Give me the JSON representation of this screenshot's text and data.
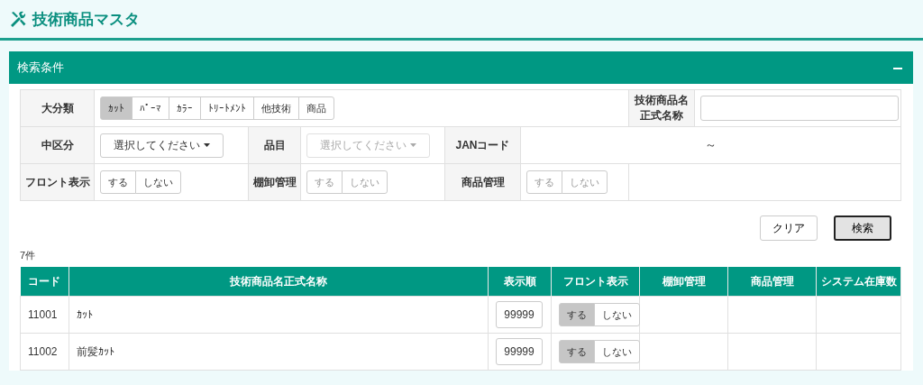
{
  "page": {
    "title": "技術商品マスタ"
  },
  "search_panel": {
    "title": "検索条件",
    "category": {
      "label": "大分類",
      "options": [
        {
          "label": "ｶｯﾄ",
          "selected": true
        },
        {
          "label": "ﾊﾟｰﾏ",
          "selected": false
        },
        {
          "label": "ｶﾗｰ",
          "selected": false
        },
        {
          "label": "ﾄﾘｰﾄﾒﾝﾄ",
          "selected": false
        },
        {
          "label": "他技術",
          "selected": false
        },
        {
          "label": "商品",
          "selected": false
        }
      ]
    },
    "name_field": {
      "label": "技術商品名正式名称"
    },
    "middle_class": {
      "label": "中区分",
      "placeholder": "選択してください",
      "disabled": false
    },
    "item": {
      "label": "品目",
      "placeholder": "選択してください",
      "disabled": true
    },
    "jan_code": {
      "label": "JANコード",
      "separator": "～"
    },
    "front_display": {
      "label": "フロント表示",
      "disabled": false,
      "options": [
        {
          "label": "する",
          "selected": false
        },
        {
          "label": "しない",
          "selected": false
        }
      ]
    },
    "inventory": {
      "label": "棚卸管理",
      "disabled": true,
      "options": [
        {
          "label": "する",
          "selected": false
        },
        {
          "label": "しない",
          "selected": false
        }
      ]
    },
    "product_mgmt": {
      "label": "商品管理",
      "disabled": true,
      "options": [
        {
          "label": "する",
          "selected": false
        },
        {
          "label": "しない",
          "selected": false
        }
      ]
    },
    "buttons": [
      {
        "label": "クリア",
        "focused": false
      },
      {
        "label": "検索",
        "focused": true
      }
    ]
  },
  "result_count": "7件",
  "table": {
    "columns": [
      "コード",
      "技術商品名正式名称",
      "表示順",
      "フロント表示",
      "棚卸管理",
      "商品管理",
      "システム在庫数"
    ],
    "rows": [
      {
        "code": "11001",
        "name": "ｶｯﾄ",
        "order": "99999",
        "front": [
          {
            "label": "する",
            "selected": true
          },
          {
            "label": "しない",
            "selected": false
          }
        ]
      },
      {
        "code": "11002",
        "name": "前髪ｶｯﾄ",
        "order": "99999",
        "front": [
          {
            "label": "する",
            "selected": true
          },
          {
            "label": "しない",
            "selected": false
          }
        ]
      }
    ]
  }
}
